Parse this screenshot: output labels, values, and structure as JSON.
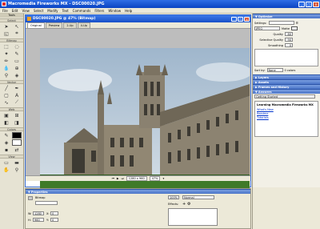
{
  "window": {
    "title": "Macromedia Fireworks MX - DSC00020.JPG",
    "min": "_",
    "max": "□",
    "close": "×"
  },
  "menu": [
    "File",
    "Edit",
    "View",
    "Select",
    "Modify",
    "Text",
    "Commands",
    "Filters",
    "Window",
    "Help"
  ],
  "tools": {
    "title": "Tools",
    "sections": [
      "Select",
      "Bitmap",
      "Vector",
      "Web",
      "Colors",
      "View"
    ]
  },
  "document": {
    "title": "DSC00020.JPG @ 47% (Bitmap)",
    "tabs": [
      "Original",
      "Preview",
      "2-Up",
      "4-Up"
    ],
    "status": {
      "size": "1280 x 960",
      "zoom": "47%"
    }
  },
  "optimize": {
    "title": "Optimize",
    "settings_label": "Settings:",
    "settings_value": "",
    "format": "JPEG",
    "matte_label": "Matte",
    "quality_label": "Quality",
    "quality_value": "80",
    "selective_label": "Selective Quality",
    "selective_value": "90",
    "smoothing_label": "Smoothing",
    "smoothing_value": "0",
    "sort_label": "Sort by:",
    "sort_value": "None",
    "colors_count": "0 colors"
  },
  "panels": [
    "Layers",
    "Assets",
    "Frames and History",
    "Answers"
  ],
  "answers": {
    "select": "Getting Started",
    "learning_title": "Learning Macromedia Fireworks MX",
    "links": [
      "What's New",
      "Readme",
      "Tutorials"
    ]
  },
  "properties": {
    "title": "Properties",
    "type": "Bitmap",
    "w": "1280",
    "h": "960",
    "x": "0",
    "y": "0",
    "opacity": "100%",
    "blend": "Normal",
    "effects_label": "Effects:"
  },
  "colors": {
    "titlebar": "#0a44c2",
    "sky": "#b8c9d8",
    "stone": "#8e8573",
    "grass": "#3f7a28"
  }
}
